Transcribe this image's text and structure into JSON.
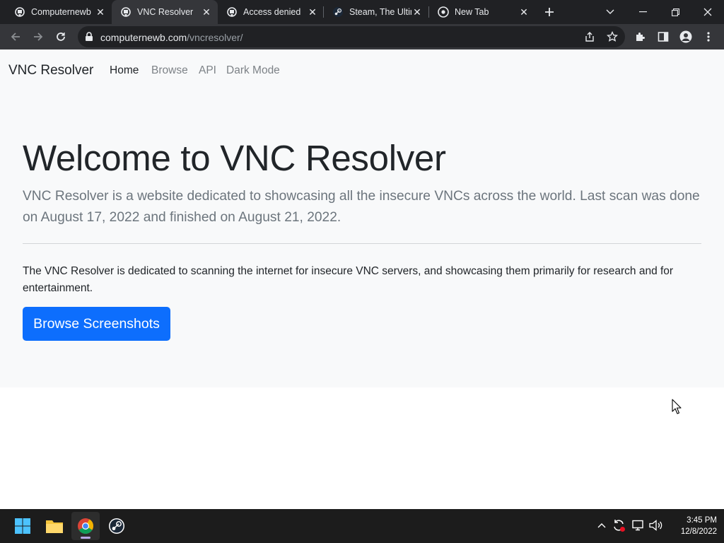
{
  "browser": {
    "tabs": [
      {
        "title": "Computernewb",
        "icon": "computernewb-favicon",
        "active": false
      },
      {
        "title": "VNC Resolver",
        "icon": "computernewb-favicon",
        "active": true
      },
      {
        "title": "Access denied",
        "icon": "computernewb-favicon",
        "active": false
      },
      {
        "title": "Steam, The Ultir",
        "icon": "steam-favicon",
        "active": false
      },
      {
        "title": "New Tab",
        "icon": "chrome-favicon",
        "active": false
      }
    ],
    "address": {
      "host": "computernewb.com",
      "path": "/vncresolver/"
    }
  },
  "site": {
    "brand": "VNC Resolver",
    "nav": [
      "Home",
      "Browse",
      "API",
      "Dark Mode"
    ],
    "hero_title": "Welcome to VNC Resolver",
    "hero_lead": "VNC Resolver is a website dedicated to showcasing all the insecure VNCs across the world. Last scan was done on August 17, 2022 and finished on August 21, 2022.",
    "body": "The VNC Resolver is dedicated to scanning the internet for insecure VNC servers, and showcasing them primarily for research and for entertainment.",
    "button": "Browse Screenshots"
  },
  "taskbar": {
    "apps": [
      "windows-start-icon",
      "file-explorer-icon",
      "chrome-icon",
      "steam-icon"
    ],
    "time": "3:45 PM",
    "date": "12/8/2022"
  },
  "colors": {
    "primary": "#0d6efd",
    "navbar_bg": "#f8f9fa",
    "browser_frame": "#202124",
    "toolbar": "#35363a"
  }
}
